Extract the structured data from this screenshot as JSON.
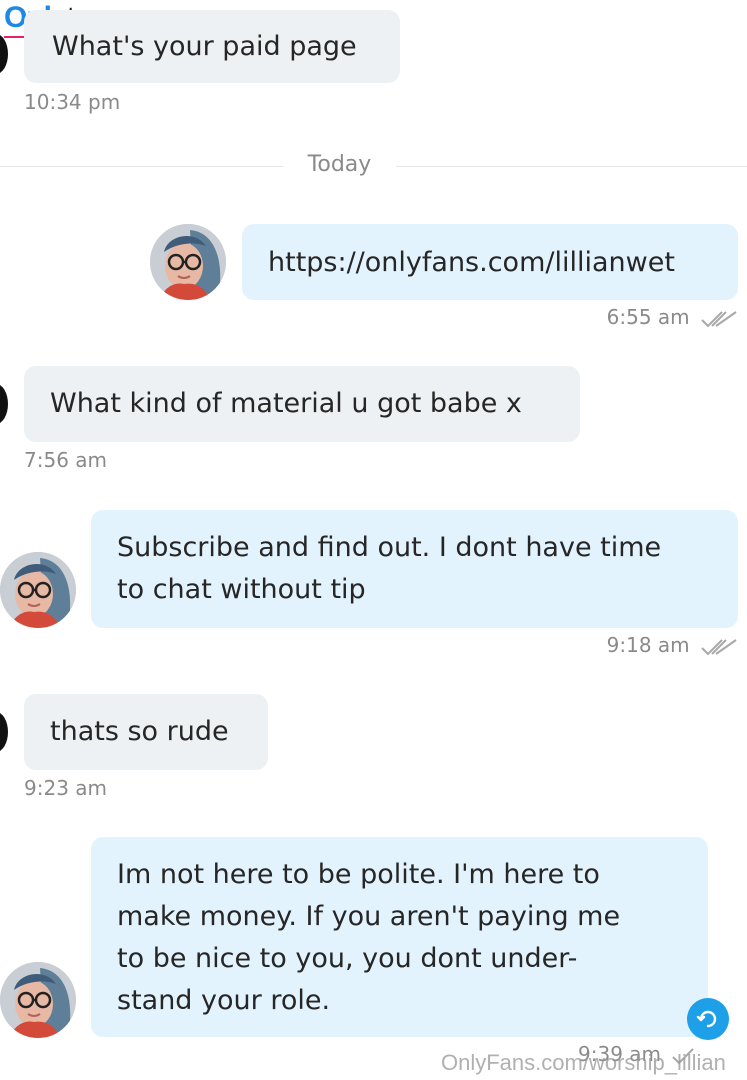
{
  "watermark_top": {
    "part1": "Only",
    "part2": "treon"
  },
  "divider_label": "Today",
  "messages": [
    {
      "text": "What's your paid page",
      "time": "10:34 pm"
    },
    {
      "text": "https://onlyfans.com/lillianwet",
      "time": "6:55 am"
    },
    {
      "text": "What kind of material u got babe x",
      "time": "7:56 am"
    },
    {
      "line1": "Subscribe and find out. I dont have time",
      "line2": "to chat without tip",
      "time": "9:18 am"
    },
    {
      "text": "thats so rude",
      "time": "9:23 am"
    },
    {
      "line1": "Im not here to be polite. I'm here to",
      "line2": "make money. If you aren't paying me",
      "line3": "to be nice to you, you dont under-",
      "line4": "stand your role.",
      "time": "9:39 am"
    }
  ],
  "watermark_bottom": "OnlyFans.com/worship_lillian",
  "icons": {
    "read_receipt": "double-check-icon",
    "scroll": "scroll-to-bottom-icon",
    "avatar": "user-avatar"
  },
  "colors": {
    "incoming_bubble": "#eef1f3",
    "outgoing_bubble": "#e3f3fd",
    "accent": "#1ea0e8"
  }
}
